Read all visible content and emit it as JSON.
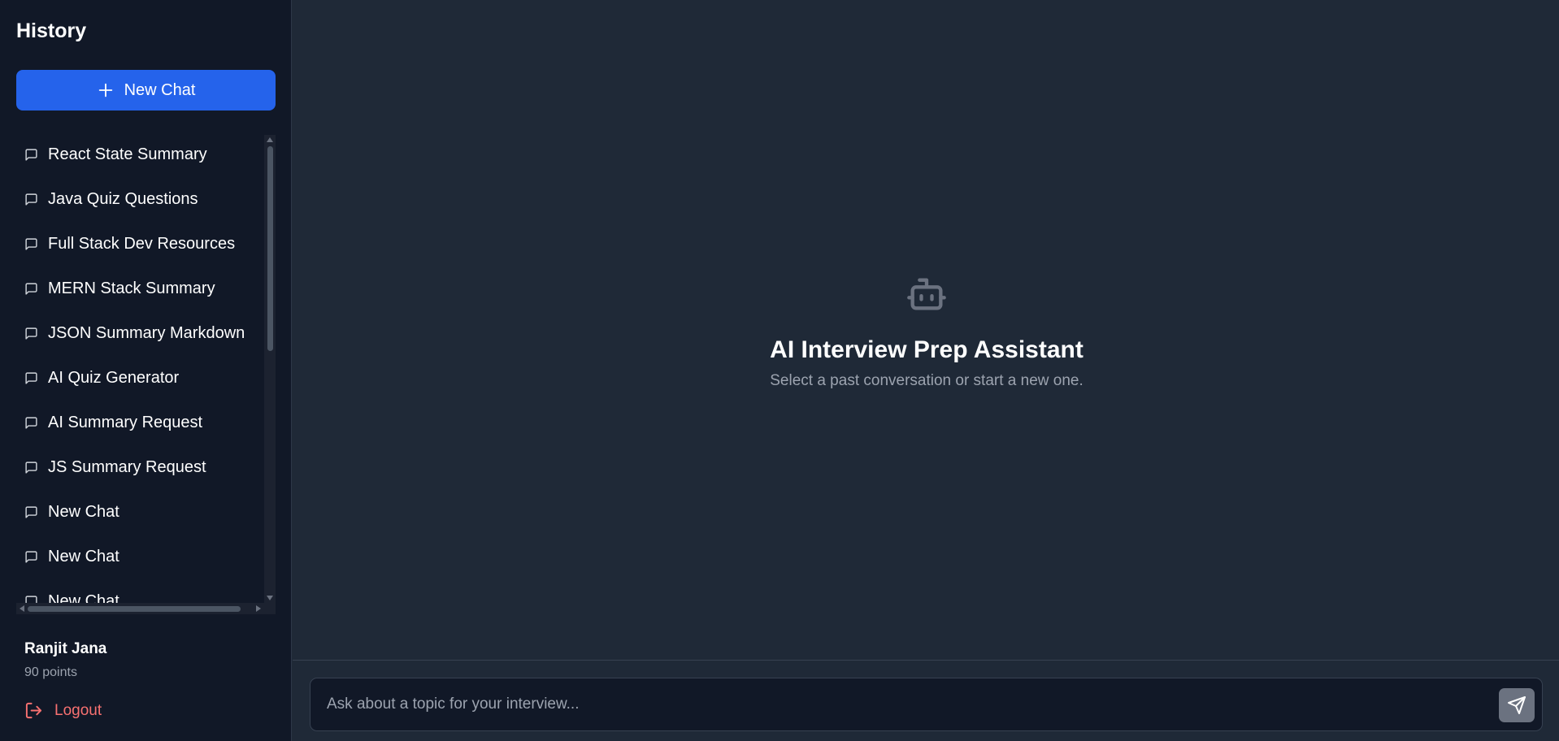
{
  "sidebar": {
    "title": "History",
    "new_chat_label": "New Chat",
    "items": [
      {
        "label": "React State Summary"
      },
      {
        "label": "Java Quiz Questions"
      },
      {
        "label": "Full Stack Dev Resources"
      },
      {
        "label": "MERN Stack Summary"
      },
      {
        "label": "JSON Summary Markdown"
      },
      {
        "label": "AI Quiz Generator"
      },
      {
        "label": "AI Summary Request"
      },
      {
        "label": "JS Summary Request"
      },
      {
        "label": "New Chat"
      },
      {
        "label": "New Chat"
      },
      {
        "label": "New Chat"
      }
    ],
    "user": {
      "name": "Ranjit Jana",
      "points": "90 points"
    },
    "logout_label": "Logout"
  },
  "main": {
    "empty_state": {
      "icon": "bot-icon",
      "title": "AI Interview Prep Assistant",
      "subtitle": "Select a past conversation or start a new one."
    },
    "input": {
      "placeholder": "Ask about a topic for your interview...",
      "value": ""
    },
    "send_icon": "send-icon"
  },
  "colors": {
    "primary": "#2563eb",
    "sidebar_bg": "#111827",
    "main_bg": "#1f2937",
    "logout": "#f87171",
    "muted": "#9ca3af"
  }
}
